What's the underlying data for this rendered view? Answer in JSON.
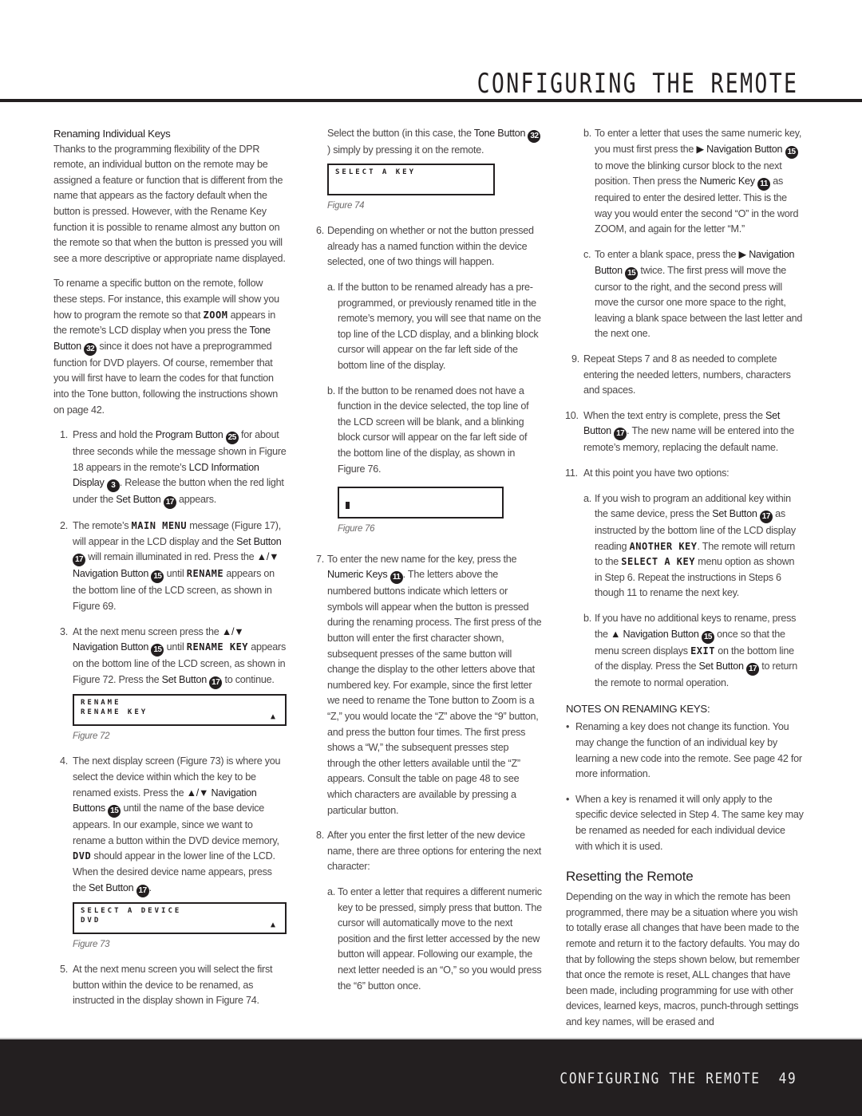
{
  "header": {
    "title": "CONFIGURING THE REMOTE"
  },
  "footer": {
    "section": "CONFIGURING THE REMOTE",
    "page_number": "49"
  },
  "col1": {
    "heading": "Renaming Individual Keys",
    "intro": "Thanks to the programming flexibility of the DPR remote, an individual button on the remote may be assigned a feature or function that is different from the name that appears as the factory default when the button is pressed. However, with the Rename Key function it is possible to rename almost any button on the remote so that when the button is pressed you will see a more descriptive or appropriate name displayed.",
    "p2_a": "To rename a specific button on the remote, follow these steps. For instance, this example will show you how to program the remote so that ",
    "p2_zoom": "ZOOM",
    "p2_b": " appears in the remote’s LCD display when you press the ",
    "p2_tone": "Tone Button",
    "p2_callout": "32",
    "p2_c": " since it does not have a preprogrammed function for DVD players. Of course, remember that you will first have to learn the codes for that function into the Tone button, following the instructions shown on page 42.",
    "step1": {
      "num": "1.",
      "a": "Press and hold the ",
      "program": "Program Button",
      "callout_program": "25",
      "b": " for about three seconds while the message shown in Figure 18 appears in the remote’s ",
      "lcd": "LCD Information Display",
      "callout_lcd": "3",
      "c": ". Release the button when the red light under the ",
      "set": "Set Button",
      "callout_set": "17",
      "d": " appears."
    },
    "step2": {
      "num": "2.",
      "a": "The remote’s ",
      "mainmenu": "MAIN MENU",
      "b": " message (Figure 17), will appear in the LCD display and the ",
      "set": "Set Button",
      "callout_set": "17",
      "c": " will remain illuminated in red. Press the ",
      "nav": "▲/▼ Navigation Button",
      "callout_nav": "15",
      "d": " until ",
      "rename": "RENAME",
      "e": " appears on the bottom line of the LCD screen, as shown in Figure 69."
    },
    "step3": {
      "num": "3.",
      "a": "At the next menu screen press the ",
      "nav": "▲/▼ Navigation Button",
      "callout_nav": "15",
      "b": " until ",
      "renamekey": "RENAME KEY",
      "c": " appears on the bottom line of the LCD screen, as shown in Figure 72. Press the ",
      "set": "Set Button",
      "callout_set": "17",
      "d": " to continue."
    },
    "fig72": {
      "line1": "RENAME",
      "line2": "RENAME KEY",
      "arrow": "▲",
      "caption": "Figure 72"
    },
    "step4": {
      "num": "4.",
      "a": "The next display screen (Figure 73) is where you select the device within which the key to be renamed exists. Press the ",
      "nav": "▲/▼ Navigation Buttons",
      "callout_nav": "15",
      "b": " until the name of the base device appears. In our example, since we want to rename a button within the DVD device memory, ",
      "dvd": "DVD",
      "c": " should appear in the lower line of the LCD. When the desired device name appears, press the ",
      "set": "Set Button",
      "callout_set": "17",
      "d": "."
    },
    "fig73": {
      "line1": "SELECT A DEVICE",
      "line2": "DVD",
      "arrow": "▲",
      "caption": "Figure 73"
    },
    "step5": {
      "num": "5.",
      "text": "At the next menu screen you will select the first button within the device to be renamed, as instructed in the display shown in Figure 74."
    }
  },
  "col2": {
    "p1_a": "Select the button (in this case, the ",
    "p1_tone": "Tone Button",
    "p1_callout": "32",
    "p1_b": ") simply by pressing it on the remote.",
    "fig74": {
      "line1": "SELECT A KEY",
      "line2": "",
      "caption": "Figure 74"
    },
    "step6": {
      "num": "6.",
      "text": "Depending on whether or not the button pressed already has a named function within the device selected, one of two things will happen.",
      "a": {
        "letter": "a.",
        "text": "If the button to be renamed already has a pre-programmed, or previously renamed title in the remote’s memory, you will see that name on the top line of the LCD display, and a blinking block cursor will appear on the far left side of the bottom line of the display."
      },
      "b": {
        "letter": "b.",
        "text": "If the button to be renamed does not have a function in the device selected, the top line of the LCD screen will be blank, and a blinking block cursor will appear on the far left side of the bottom line of the display, as shown in Figure 76."
      }
    },
    "fig76": {
      "caption": "Figure 76"
    },
    "step7": {
      "num": "7.",
      "a": "To enter the new name for the key, press the ",
      "numeric": "Numeric Keys",
      "callout": "11",
      "b": ". The letters above the numbered buttons indicate which letters or symbols will appear when the button is pressed during the renaming process. The first press of the button will enter the first character shown, subsequent presses of the same button will change the display to the other letters above that numbered key. For example, since the first letter we need to rename the Tone button to Zoom is a “Z,” you would locate the “Z” above the “9” button, and press the button four times. The first press shows a “W,” the subsequent presses step through the other letters available until the “Z” appears. Consult the table on page 48 to see which characters are available by pressing a particular button."
    },
    "step8": {
      "num": "8.",
      "text": "After you enter the first letter of the new device name, there are three options for entering the next character:",
      "a": {
        "letter": "a.",
        "text": "To enter a letter that requires a different numeric key to be pressed, simply press that button. The cursor will automatically move to the next position and the first letter accessed by the new button will appear. Following our example, the next letter needed is an “O,” so you would press the “6” button once."
      }
    }
  },
  "col3": {
    "step8b": {
      "letter": "b.",
      "a": "To enter a letter that uses the same numeric key, you must first press the ",
      "nav": "▶ Navigation Button",
      "callout_nav": "15",
      "b": " to move the blinking cursor block to the next position. Then press the ",
      "numeric": "Numeric Key",
      "callout_num": "11",
      "c": " as required to enter the desired letter. This is the way you would enter the second “O” in the word ZOOM, and again for the letter “M.”"
    },
    "step8c": {
      "letter": "c.",
      "a": "To enter a blank space, press the ",
      "nav": "▶ Navigation Button",
      "callout_nav": "15",
      "b": " twice. The first press will move the cursor to the right, and the second press will move the cursor one more space to the right, leaving a blank space between the last letter and the next one."
    },
    "step9": {
      "num": "9.",
      "text": "Repeat Steps 7 and 8 as needed to complete entering the needed letters, numbers, characters and spaces."
    },
    "step10": {
      "num": "10.",
      "a": "When the text entry is complete, press the ",
      "set": "Set Button",
      "callout_set": "17",
      "b": ". The new name will be entered into the remote’s memory, replacing the default name."
    },
    "step11": {
      "num": "11.",
      "text": "At this point you have two options:",
      "a": {
        "letter": "a.",
        "a": "If you wish to program an additional key within the same device, press the ",
        "set": "Set Button",
        "callout_set": "17",
        "b": " as instructed by the bottom line of the LCD display reading ",
        "another": "ANOTHER KEY",
        "c": ". The remote will return to the ",
        "selectkey": "SELECT A KEY",
        "d": " menu option as shown in Step 6. Repeat the instructions in Steps 6 though 11 to rename the next key."
      },
      "b": {
        "letter": "b.",
        "a": "If you have no additional keys to rename, press the ",
        "nav": "▲ Navigation Button",
        "callout_nav": "15",
        "b": " once so that the menu screen displays ",
        "exit": "EXIT",
        "c": " on the bottom line of the display. Press the ",
        "set": "Set Button",
        "callout_set": "17",
        "d": " to return the remote to normal operation."
      }
    },
    "notes_heading": "NOTES ON RENAMING KEYS:",
    "notes": [
      "Renaming a key does not change its function. You may change the function of an individual key by learning a new code into the remote. See page 42 for more information.",
      "When a key is renamed it will only apply to the specific device selected in Step 4. The same key may be renamed as needed for each individual device with which it is used."
    ],
    "bullet": "•",
    "reset_heading": "Resetting the Remote",
    "reset_text": "Depending on the way in which the remote has been programmed, there may be a situation where you wish to totally erase all changes that have been made to the remote and return it to the factory defaults. You may do that by following the steps shown below, but remember that once the remote is reset, ALL changes that have been made, including programming for use with other devices, learned keys, macros, punch-through settings and key names, will be erased and"
  }
}
